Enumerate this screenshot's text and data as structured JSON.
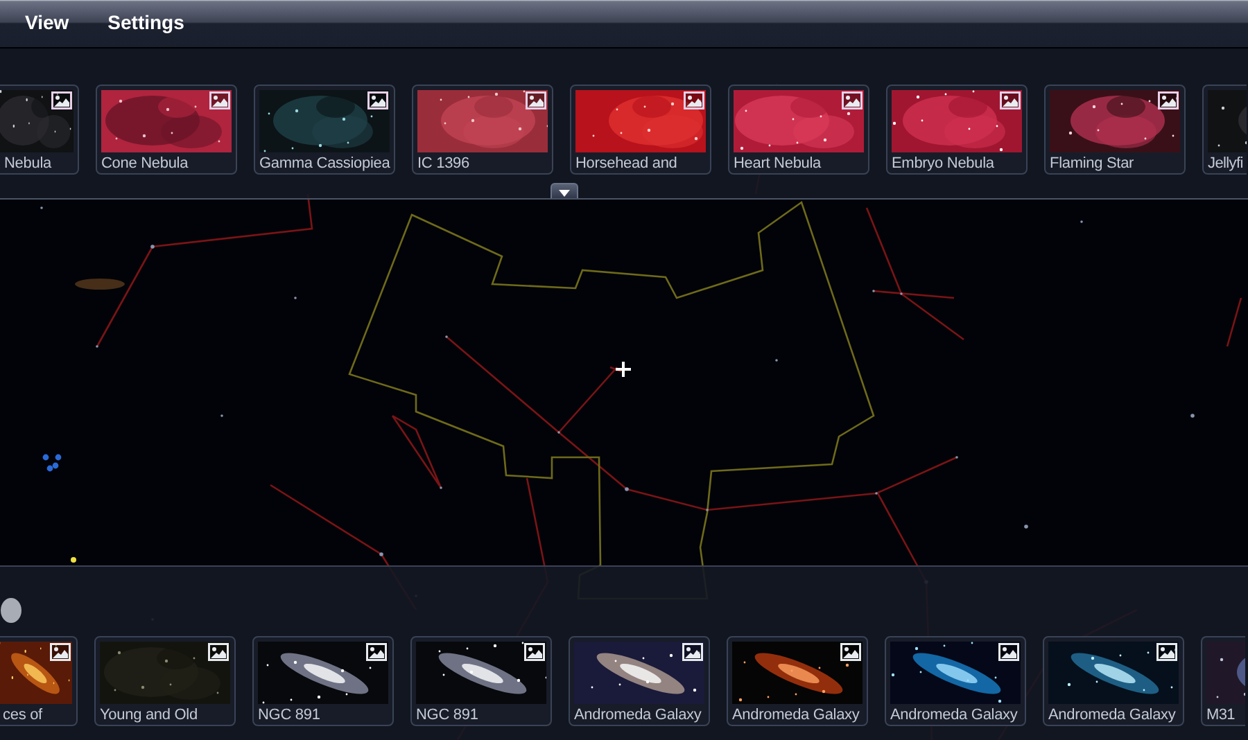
{
  "menu": [
    {
      "label": "View"
    },
    {
      "label": "Settings"
    }
  ],
  "top_strip": {
    "items": [
      {
        "label": "Nebula",
        "kind": "picture"
      },
      {
        "label": "Cone Nebula",
        "kind": "picture"
      },
      {
        "label": "Gamma Cassiopiea",
        "kind": "picture"
      },
      {
        "label": "IC 1396",
        "kind": "picture"
      },
      {
        "label": "Horsehead and",
        "kind": "picture"
      },
      {
        "label": "Heart Nebula",
        "kind": "picture"
      },
      {
        "label": "Embryo Nebula",
        "kind": "picture"
      },
      {
        "label": "Flaming Star",
        "kind": "picture"
      },
      {
        "label": "Jellyfi",
        "kind": "picture"
      }
    ]
  },
  "bottom_strip": {
    "items": [
      {
        "label": "ces of",
        "kind": "picture"
      },
      {
        "label": "Young and Old",
        "kind": "picture"
      },
      {
        "label": "NGC 891",
        "kind": "picture"
      },
      {
        "label": "NGC 891",
        "kind": "picture"
      },
      {
        "label": "Andromeda Galaxy",
        "kind": "picture"
      },
      {
        "label": "Andromeda Galaxy",
        "kind": "picture"
      },
      {
        "label": "Andromeda Galaxy",
        "kind": "picture"
      },
      {
        "label": "Andromeda Galaxy",
        "kind": "picture"
      },
      {
        "label": "M31",
        "kind": "picture"
      }
    ]
  }
}
